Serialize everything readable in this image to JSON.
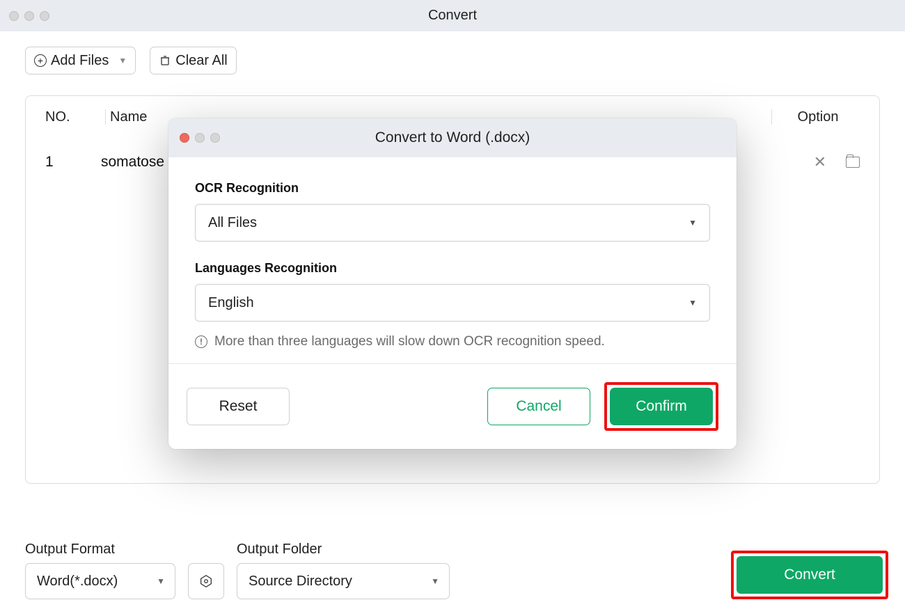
{
  "window": {
    "title": "Convert"
  },
  "toolbar": {
    "add_files_label": "Add Files",
    "clear_all_label": "Clear All"
  },
  "table": {
    "headers": {
      "no": "NO.",
      "name": "Name",
      "option": "Option"
    },
    "rows": [
      {
        "no": "1",
        "name": "somatose"
      }
    ]
  },
  "bottom": {
    "output_format_label": "Output Format",
    "output_format_value": "Word(*.docx)",
    "output_folder_label": "Output Folder",
    "output_folder_value": "Source Directory",
    "convert_button": "Convert"
  },
  "modal": {
    "title": "Convert to Word (.docx)",
    "ocr_label": "OCR Recognition",
    "ocr_value": "All Files",
    "lang_label": "Languages Recognition",
    "lang_value": "English",
    "hint": "More than three languages will slow down OCR recognition speed.",
    "reset": "Reset",
    "cancel": "Cancel",
    "confirm": "Confirm"
  }
}
